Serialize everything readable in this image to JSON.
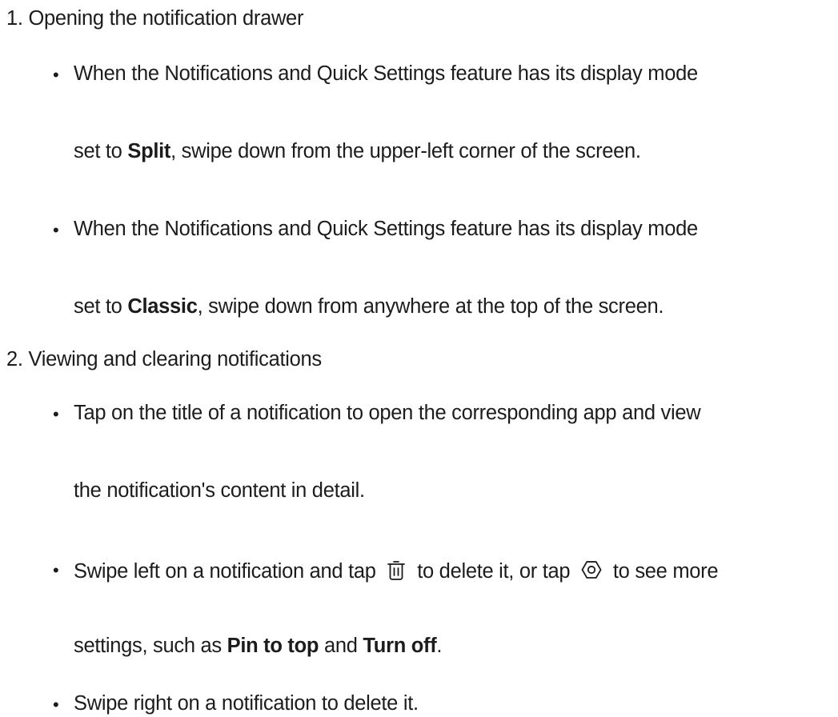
{
  "sections": [
    {
      "number": "1.",
      "title": "Opening the notification drawer",
      "bullets": [
        {
          "line1": "When the Notifications and Quick Settings feature has its display mode",
          "line2_a": "set to ",
          "line2_bold": "Split",
          "line2_b": ", swipe down from the upper-left corner of the screen."
        },
        {
          "line1": "When the Notifications and Quick Settings feature has its display mode",
          "line2_a": "set to ",
          "line2_bold": "Classic",
          "line2_b": ", swipe down from anywhere at the top of the screen."
        }
      ]
    },
    {
      "number": "2.",
      "title": "Viewing and clearing notifications",
      "bullets": [
        {
          "line1": "Tap on the title of a notification to open the corresponding app and view",
          "line2": "the notification's content in detail."
        },
        {
          "line1_a": "Swipe left on a notification and tap",
          "line1_b": "to delete it, or tap",
          "line1_c": "to see more",
          "line2_a": "settings, such as ",
          "line2_bold1": "Pin to top",
          "line2_mid": " and ",
          "line2_bold2": "Turn off",
          "line2_end": "."
        },
        {
          "line1": "Swipe right on a notification to delete it."
        }
      ]
    }
  ],
  "bullet_char": "•",
  "icons": {
    "delete": "trash-icon",
    "settings": "settings-icon"
  }
}
